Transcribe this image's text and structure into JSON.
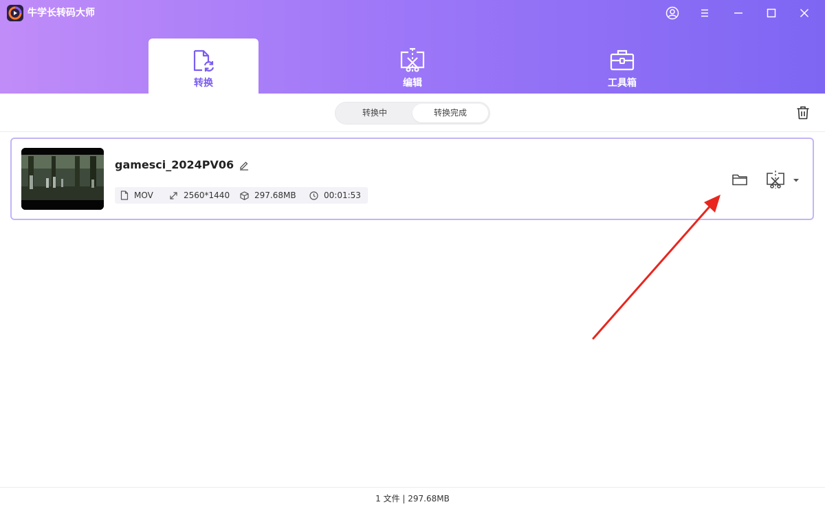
{
  "app": {
    "title": "牛学长转码大师"
  },
  "nav": {
    "tabs": [
      {
        "label": "转换",
        "icon": "convert-file-icon",
        "active": true
      },
      {
        "label": "编辑",
        "icon": "edit-video-icon",
        "active": false
      },
      {
        "label": "工具箱",
        "icon": "toolbox-icon",
        "active": false
      }
    ]
  },
  "status_tabs": [
    {
      "label": "转换中",
      "active": false
    },
    {
      "label": "转换完成",
      "active": true
    }
  ],
  "file": {
    "name": "gamesci_2024PV06",
    "format": "MOV",
    "resolution": "2560*1440",
    "size": "297.68MB",
    "duration": "00:01:53"
  },
  "footer": {
    "summary": "1 文件 | 297.68MB"
  },
  "colors": {
    "accent": "#7b5cf0",
    "header_start": "#c08cf8",
    "header_end": "#7e66f3",
    "card_border": "#c3b5f6",
    "annotation": "#e8261e"
  }
}
